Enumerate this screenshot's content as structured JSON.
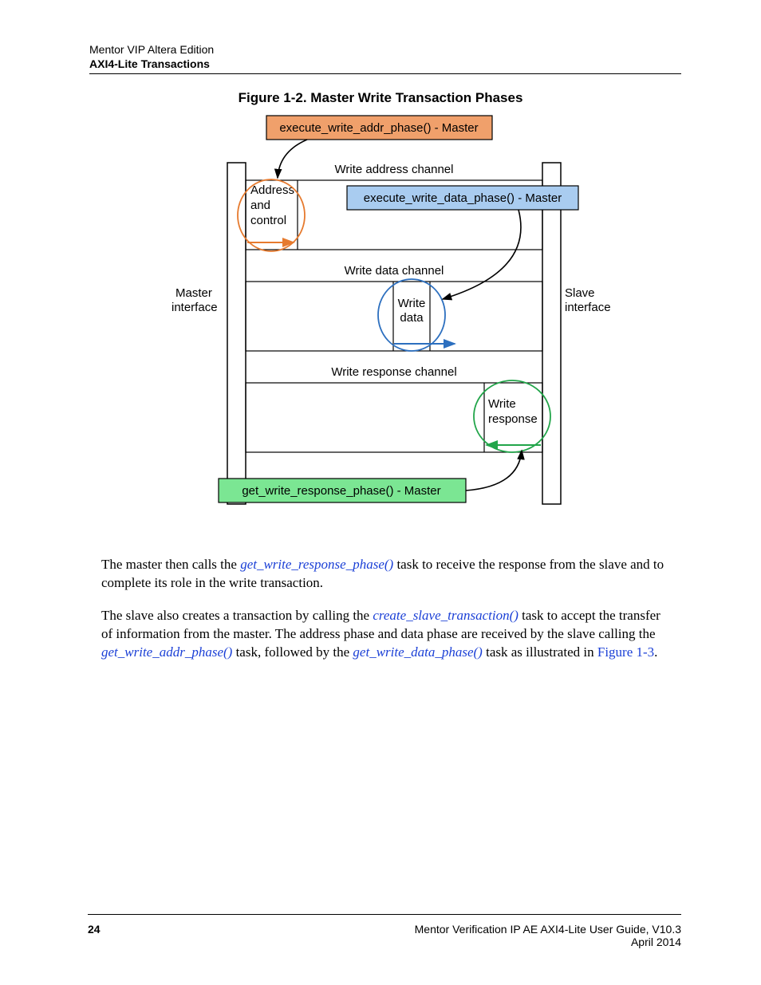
{
  "header": {
    "line1": "Mentor VIP Altera Edition",
    "line2": "AXI4-Lite Transactions"
  },
  "figure": {
    "caption": "Figure 1-2. Master Write Transaction Phases",
    "boxes": {
      "addr_phase": "execute_write_addr_phase() - Master",
      "data_phase": "execute_write_data_phase() - Master",
      "resp_phase": "get_write_response_phase() - Master"
    },
    "channel_labels": {
      "addr": "Write address channel",
      "data": "Write data channel",
      "resp": "Write response channel"
    },
    "inline_labels": {
      "addr_ctrl_1": "Address",
      "addr_ctrl_2": "and",
      "addr_ctrl_3": "control",
      "write_data_1": "Write",
      "write_data_2": "data",
      "write_resp_1": "Write",
      "write_resp_2": "response"
    },
    "side_labels": {
      "master_1": "Master",
      "master_2": "interface",
      "slave_1": "Slave",
      "slave_2": "interface"
    }
  },
  "body": {
    "p1_a": "The master then calls the ",
    "p1_link": "get_write_response_phase()",
    "p1_b": " task to receive the response from the slave and to complete its role in the write transaction.",
    "p2_a": "The slave also creates a transaction by calling the ",
    "p2_link1": "create_slave_transaction()",
    "p2_b": " task to accept the transfer of information from the master. The address phase and data phase are received by the slave calling the ",
    "p2_link2": "get_write_addr_phase()",
    "p2_c": " task, followed by the ",
    "p2_link3": "get_write_data_phase()",
    "p2_d": " task as illustrated in ",
    "p2_figref": "Figure 1-3",
    "p2_e": "."
  },
  "footer": {
    "page": "24",
    "title": "Mentor Verification IP AE AXI4-Lite User Guide, V10.3",
    "date": "April 2014"
  }
}
